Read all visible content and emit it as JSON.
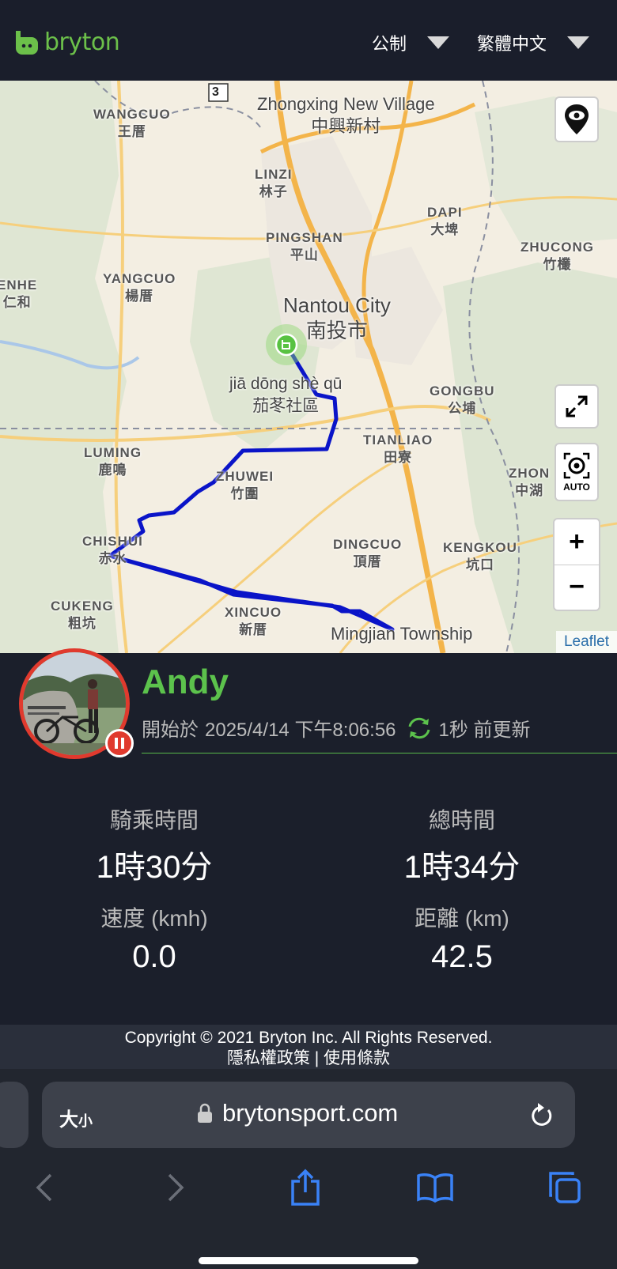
{
  "header": {
    "brand": "bryton",
    "units_select": "公制",
    "language_select": "繁體中文"
  },
  "map": {
    "labels": [
      {
        "en": "WANGCUO",
        "zh": "王厝"
      },
      {
        "en": "Zhongxing New Village",
        "zh": "中興新村"
      },
      {
        "en": "LINZI",
        "zh": "林子"
      },
      {
        "en": "DAPI",
        "zh": "大埤"
      },
      {
        "en": "PINGSHAN",
        "zh": "平山"
      },
      {
        "en": "ZHUCONG",
        "zh": "竹欉"
      },
      {
        "en": "YANGCUO",
        "zh": "楊厝"
      },
      {
        "en": "ENHE",
        "zh": "仁和"
      },
      {
        "en": "Nantou City",
        "zh": "南投市"
      },
      {
        "en": "jiā dōng shè qū",
        "zh": "茄苳社區"
      },
      {
        "en": "GONGBU",
        "zh": "公埔"
      },
      {
        "en": "TIANLIAO",
        "zh": "田寮"
      },
      {
        "en": "LUMING",
        "zh": "鹿鳴"
      },
      {
        "en": "ZHUWEI",
        "zh": "竹圍"
      },
      {
        "en": "ZHON",
        "zh": "中湖"
      },
      {
        "en": "CHISHUI",
        "zh": "赤水"
      },
      {
        "en": "DINGCUO",
        "zh": "頂厝"
      },
      {
        "en": "KENGKOU",
        "zh": "坑口"
      },
      {
        "en": "CUKENG",
        "zh": "粗坑"
      },
      {
        "en": "XINCUO",
        "zh": "新厝"
      },
      {
        "en": "Mingjian Township",
        "zh": ""
      }
    ],
    "road_shield": "3",
    "auto_label": "AUTO",
    "zoom_in": "+",
    "zoom_out": "−",
    "attribution": "Leaflet"
  },
  "rider": {
    "name": "Andy",
    "started_label": "開始於",
    "start_time": "2025/4/14 下午8:06:56",
    "updated": "1秒 前更新",
    "status": "paused"
  },
  "stats": {
    "ride_time_label": "騎乘時間",
    "ride_time_value": "1時30分",
    "total_time_label": "總時間",
    "total_time_value": "1時34分",
    "speed_label": "速度 (kmh)",
    "speed_value": "0.0",
    "distance_label": "距離 (km)",
    "distance_value": "42.5"
  },
  "footer": {
    "copyright": "Copyright © 2021 Bryton Inc. All Rights Reserved.",
    "links": "隱私權政策 | 使用條款"
  },
  "browser": {
    "text_size": "大",
    "text_size_small": "小",
    "url": "brytonsport.com"
  },
  "colors": {
    "brand_green": "#6cc04a",
    "route_blue": "#0a14c8",
    "pause_red": "#e03a2e",
    "ios_blue": "#3a82f7"
  }
}
